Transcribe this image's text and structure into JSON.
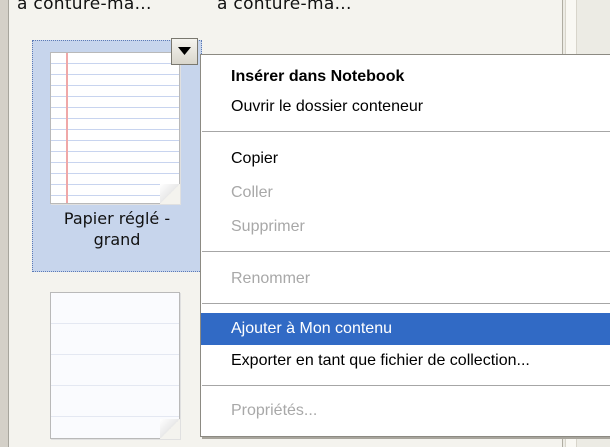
{
  "gallery": {
    "truncated_labels": [
      "à conture-ma...",
      "à conture-ma..."
    ],
    "items": [
      {
        "label_line1": "Papier réglé -",
        "label_line2": "grand",
        "selected": true
      },
      {
        "label_line1": "",
        "label_line2": "",
        "selected": false
      }
    ]
  },
  "context_menu": {
    "items": [
      {
        "label": "Insérer dans Notebook",
        "bold": true,
        "enabled": true
      },
      {
        "label": "Ouvrir le dossier conteneur",
        "enabled": true
      },
      {
        "label": "Copier",
        "enabled": true
      },
      {
        "label": "Coller",
        "enabled": false
      },
      {
        "label": "Supprimer",
        "enabled": false
      },
      {
        "label": "Renommer",
        "enabled": false
      },
      {
        "label": "Ajouter à Mon contenu",
        "enabled": true,
        "highlighted": true
      },
      {
        "label": "Exporter en tant que fichier de collection...",
        "enabled": true
      },
      {
        "label": "Propriétés...",
        "enabled": false
      }
    ]
  },
  "colors": {
    "highlight": "#316ac5",
    "selection_bg": "#c7d5ec",
    "disabled_text": "#a8a8a8"
  }
}
